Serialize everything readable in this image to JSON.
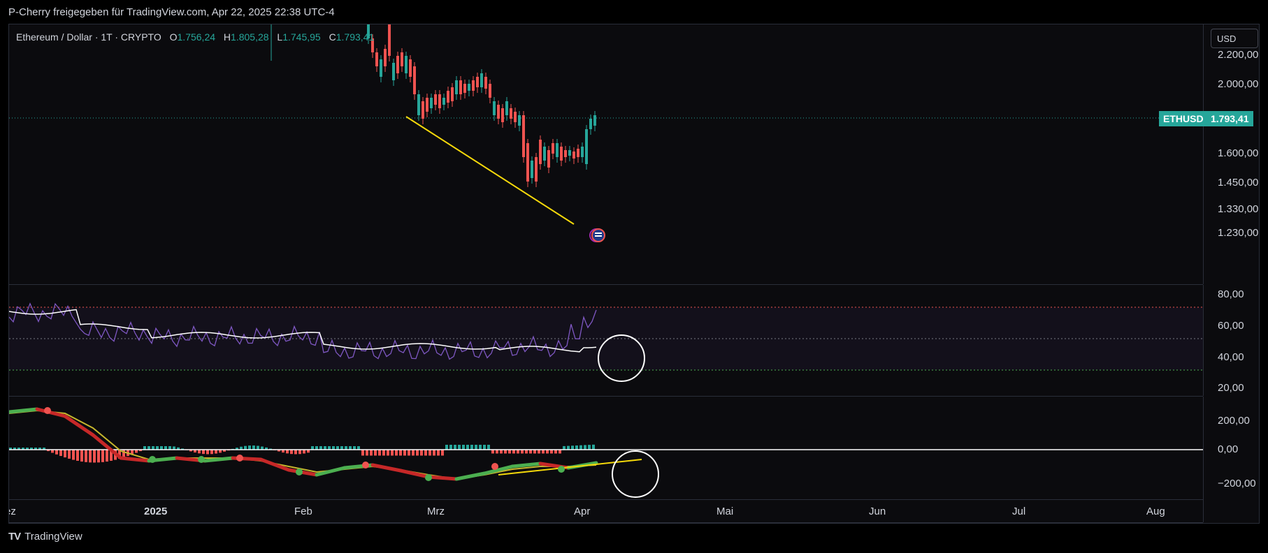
{
  "header": {
    "title": "P-Cherry freigegeben für TradingView.com, Apr 22, 2025 22:38 UTC-4"
  },
  "legend": {
    "symbol": "Ethereum / Dollar · 1T · CRYPTO",
    "o_label": "O",
    "o_value": "1.756,24",
    "h_label": "H",
    "h_value": "1.805,28",
    "l_label": "L",
    "l_value": "1.745,95",
    "c_label": "C",
    "c_value": "1.793,41"
  },
  "price_axis": {
    "currency": "USD",
    "ticks": [
      "2.200,00",
      "2.000,00",
      "1.600,00",
      "1.450,00",
      "1.330,00",
      "1.230,00"
    ],
    "symbol_badge": "ETHUSD",
    "last_price": "1.793,41"
  },
  "rsi_axis": {
    "ticks": [
      "80,00",
      "60,00",
      "40,00",
      "20,00"
    ]
  },
  "macd_axis": {
    "ticks": [
      "200,00",
      "0,00",
      "−200,00"
    ]
  },
  "time_axis": {
    "labels": [
      "ez",
      "2025",
      "Feb",
      "Mrz",
      "Apr",
      "Mai",
      "Jun",
      "Jul",
      "Aug"
    ]
  },
  "footer": {
    "brand": "TradingView",
    "logo": "TV"
  },
  "colors": {
    "up": "#26a69a",
    "down": "#ef5350",
    "trendline": "#f5d90a",
    "rsi": "#7e57c2",
    "background": "#0b0b0e"
  }
}
